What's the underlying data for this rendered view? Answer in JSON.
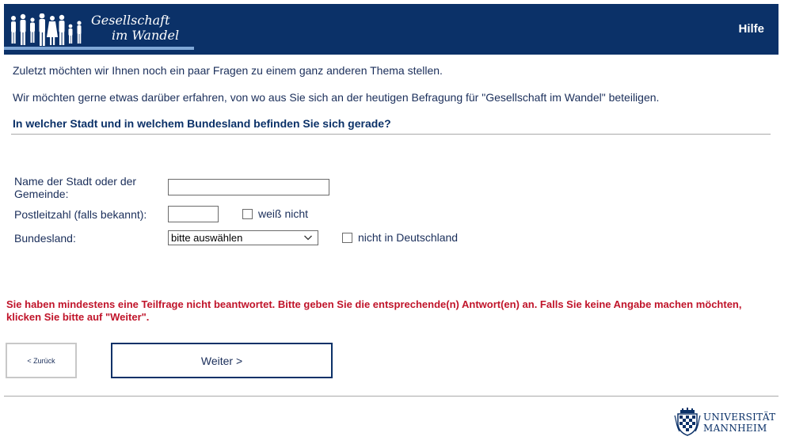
{
  "header": {
    "logo_line1": "Gesellschaft",
    "logo_line2": "im Wandel",
    "help_label": "Hilfe"
  },
  "intro": {
    "line1": "Zuletzt möchten wir Ihnen noch ein paar Fragen zu einem ganz anderen Thema stellen.",
    "line2": "Wir möchten gerne etwas darüber erfahren, von wo aus Sie sich an der heutigen Befragung für \"Gesellschaft im Wandel\" beteiligen."
  },
  "question": "In welcher Stadt und in welchem Bundesland befinden Sie sich gerade?",
  "form": {
    "city_label": "Name der Stadt oder der Gemeinde:",
    "city_value": "",
    "plz_label": "Postleitzahl (falls bekannt):",
    "plz_value": "",
    "plz_unknown_label": "weiß nicht",
    "state_label": "Bundesland:",
    "state_selected": "bitte auswählen",
    "not_in_germany_label": "nicht in Deutschland"
  },
  "error_message": "Sie haben mindestens eine Teilfrage nicht beantwortet. Bitte geben Sie die entsprechende(n) Antwort(en) an. Falls Sie keine Angabe machen möchten, klicken Sie bitte auf \"Weiter\".",
  "nav": {
    "back_label": "< Zurück",
    "next_label": "Weiter >"
  },
  "footer": {
    "uni_line1": "UNIVERSITÄT",
    "uni_line2": "MANNHEIM"
  },
  "colors": {
    "header_bg": "#0b3168",
    "error": "#c0142a",
    "text": "#1a2e5a"
  }
}
